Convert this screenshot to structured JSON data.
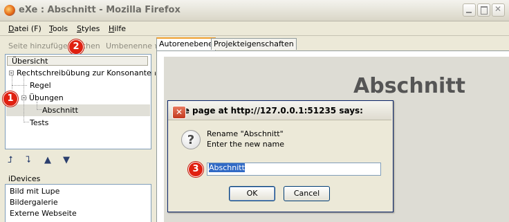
{
  "window": {
    "title": "eXe : Abschnitt - Mozilla Firefox"
  },
  "menu": {
    "items": [
      "Datei (F)",
      "Tools",
      "Styles",
      "Hilfe"
    ]
  },
  "toolbar": {
    "add_page": "Seite hinzufügen",
    "delete": "chen",
    "rename": "Umbenennen"
  },
  "tree": {
    "header": "Übersicht",
    "root": "Rechtschreibübung zur Konsonanten...",
    "regel": "Regel",
    "uebungen": "Übungen",
    "abschnitt": "Abschnitt",
    "tests": "Tests"
  },
  "idevices": {
    "label": "iDevices",
    "items": [
      "Bild mit Lupe",
      "Bildergalerie",
      "Externe Webseite"
    ]
  },
  "tabs": {
    "authoring": "Autorenebene",
    "properties": "Projekteigenschaften"
  },
  "content": {
    "page_title": "Abschnitt"
  },
  "dialog": {
    "title": "The page at http://127.0.0.1:51235 says:",
    "line1": "Rename \"Abschnitt\"",
    "line2": "Enter the new name",
    "value": "Abschnitt",
    "ok": "OK",
    "cancel": "Cancel"
  },
  "badges": {
    "b1": "1",
    "b2": "2",
    "b3": "3"
  },
  "colors": {
    "badge": "#e02010",
    "selection": "#316ac5",
    "tab_accent": "#f0a030"
  }
}
